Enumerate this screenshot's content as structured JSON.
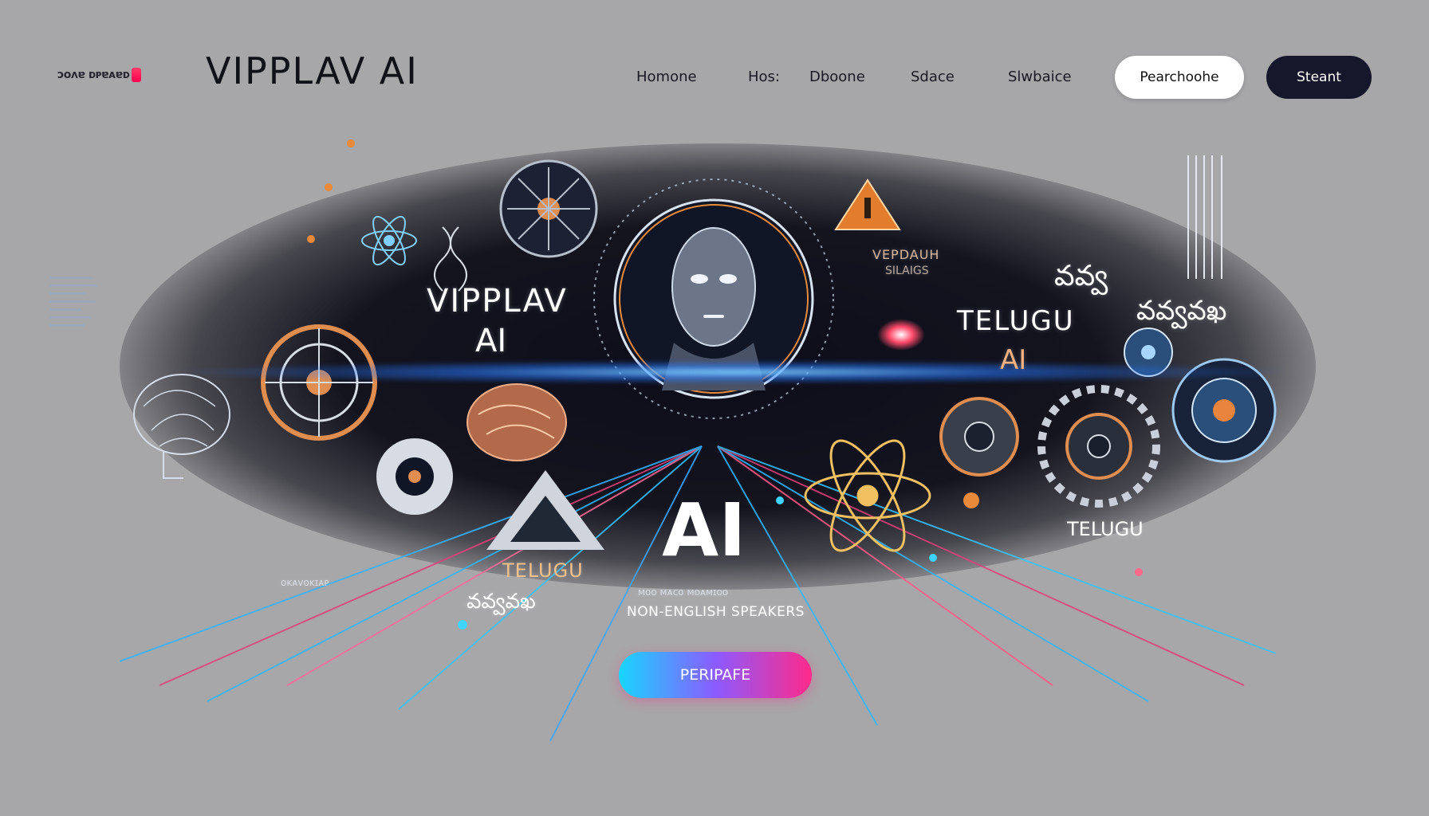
{
  "header": {
    "logo_small_text": "ᴐᴏᴧɐ ᴅᴘɐᴀɐᴅ",
    "brand": "VIPPLAV AI",
    "nav": [
      "Homone",
      "Hos:",
      "Dboone",
      "Sdace",
      "Slwbaice"
    ],
    "btn_light_label": "Pearchoohe",
    "btn_dark_label": "Steant"
  },
  "hero": {
    "vipplav_line1": "VIPPLAV",
    "vipplav_line2": "AI",
    "right_small_line1": "VEPDAUH",
    "right_small_line2": "SILAIGS",
    "telugu_right_line1": "TELUGU",
    "telugu_right_line2": "AI",
    "telugu_glyphs_top1": "వవ్వ",
    "telugu_glyphs_top2": "వవ్వవఖ",
    "telugu_bottom_left": "TELUGU",
    "telugu_glyphs_bottom": "వవ్వవఖ",
    "telugu_right_low": "TELUGU",
    "big_ai": "AI",
    "tagline_small": "ᴍᴏᴏ ᴍᴀᴄᴏ ᴍᴏᴀᴍɪᴏᴏ",
    "tagline": "NON-ENGLISH SPEAKERS",
    "left_small_caption": "ᴏᴋᴀᴠᴏᴋɪᴀᴘ",
    "cta_label": "PERIPAFE",
    "icons": [
      "brain-icon",
      "gear-icon",
      "atom-icon",
      "dna-icon",
      "warning-triangle-icon",
      "robot-face-icon",
      "eye-lens-icon"
    ],
    "colors": {
      "accent_cyan": "#18d6ff",
      "accent_pink": "#ff2a8a",
      "accent_orange": "#e88a3a",
      "dark": "#17172b"
    }
  }
}
